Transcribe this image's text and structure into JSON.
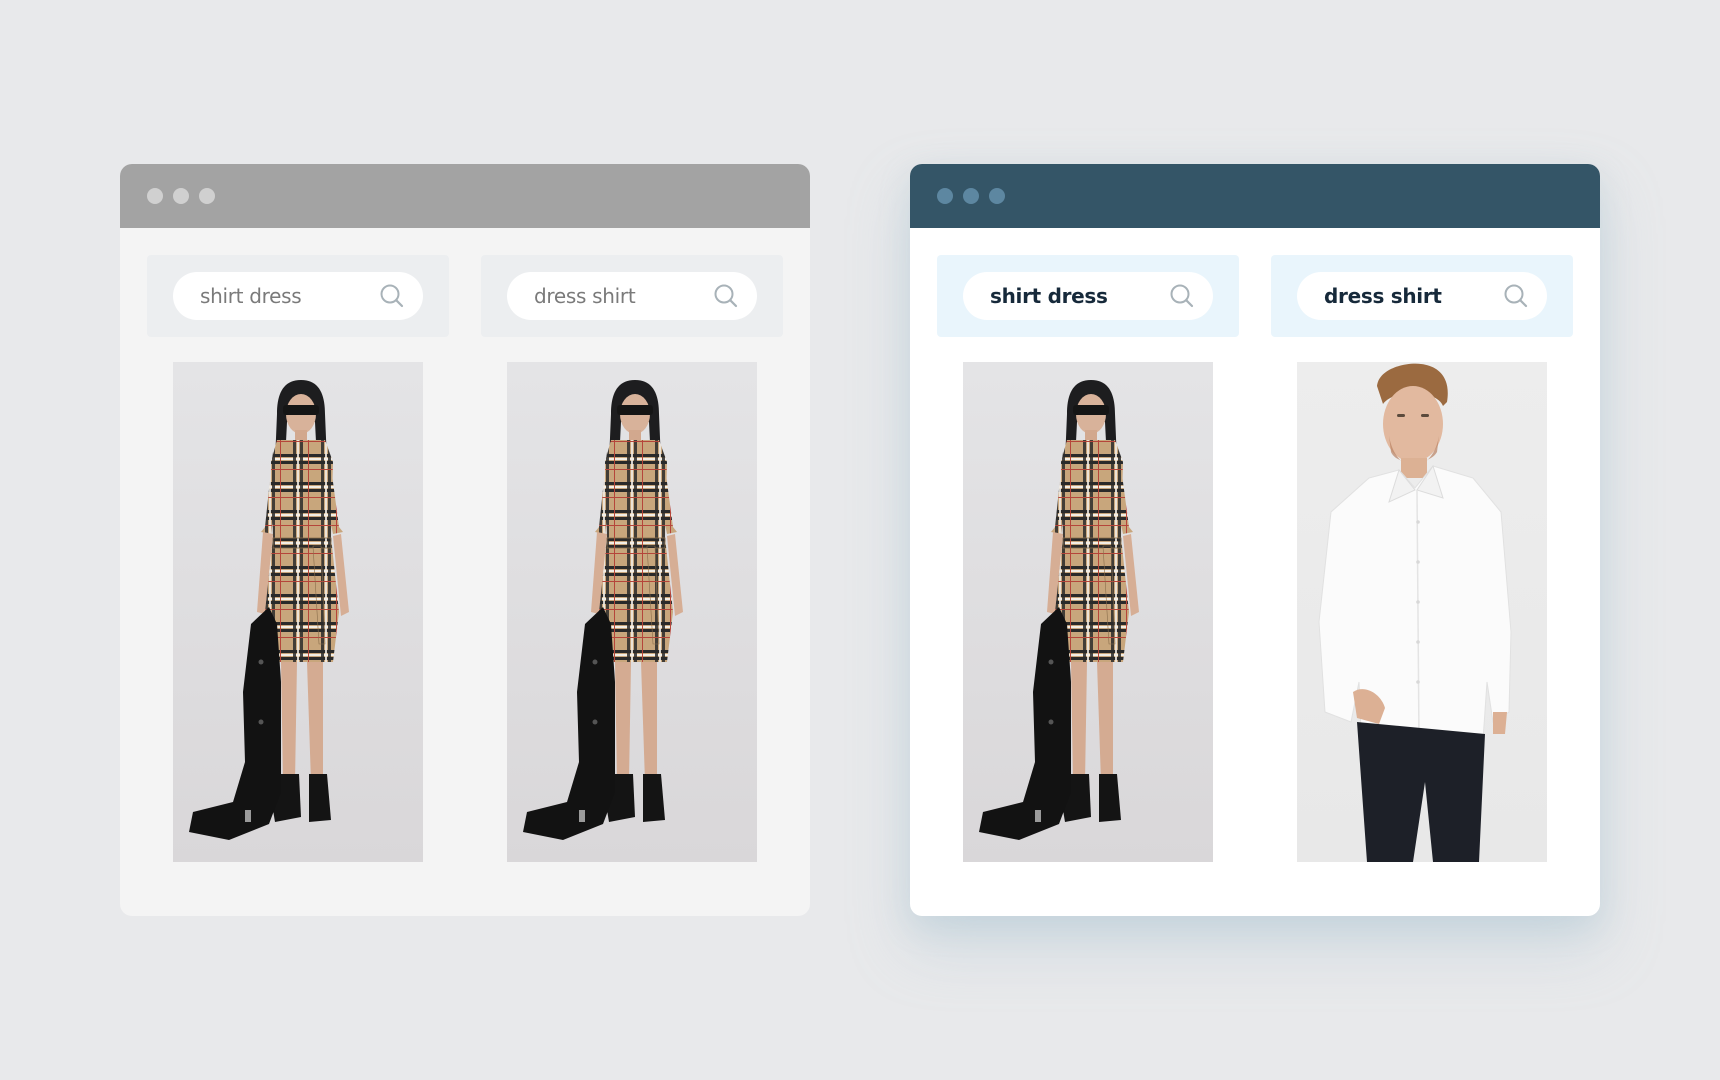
{
  "colors": {
    "background": "#e8e9eb",
    "left_titlebar": "#a3a3a3",
    "right_titlebar": "#345567",
    "left_panel": "#eceef0",
    "right_panel": "#e9f5fc"
  },
  "windows": [
    {
      "variant": "generic",
      "columns": [
        {
          "query": "shirt dress",
          "search_icon": "search-icon",
          "result": {
            "product": "plaid shirt dress",
            "image_desc": "Model in beige check shirt dress holding black trench coat"
          }
        },
        {
          "query": "dress shirt",
          "search_icon": "search-icon",
          "result": {
            "product": "plaid shirt dress",
            "image_desc": "Model in beige check shirt dress holding black trench coat"
          }
        }
      ]
    },
    {
      "variant": "semantic",
      "columns": [
        {
          "query": "shirt dress",
          "search_icon": "search-icon",
          "result": {
            "product": "plaid shirt dress",
            "image_desc": "Model in beige check shirt dress holding black trench coat"
          }
        },
        {
          "query": "dress shirt",
          "search_icon": "search-icon",
          "result": {
            "product": "white dress shirt",
            "image_desc": "Man in white button-down dress shirt and dark jeans"
          }
        }
      ]
    }
  ]
}
